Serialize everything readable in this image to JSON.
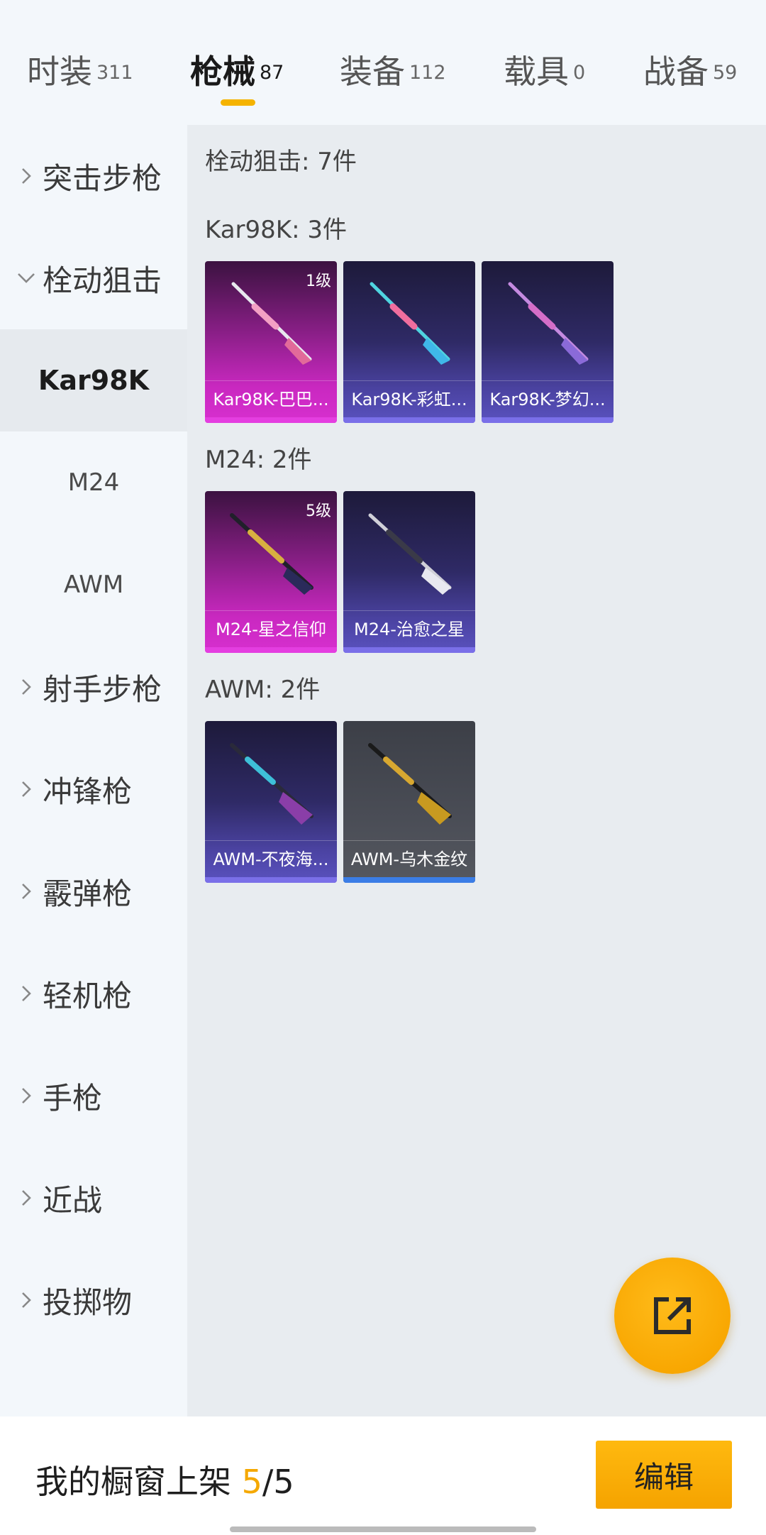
{
  "tabs": [
    {
      "label": "时装",
      "count": "311"
    },
    {
      "label": "枪械",
      "count": "87"
    },
    {
      "label": "装备",
      "count": "112"
    },
    {
      "label": "载具",
      "count": "0"
    },
    {
      "label": "战备",
      "count": "59"
    }
  ],
  "sidebar": {
    "categories": [
      "突击步枪",
      "栓动狙击",
      "射手步枪",
      "冲锋枪",
      "霰弹枪",
      "轻机枪",
      "手枪",
      "近战",
      "投掷物"
    ],
    "subitems": [
      "Kar98K",
      "M24",
      "AWM"
    ]
  },
  "main": {
    "section_title": "栓动狙击: 7件",
    "groups": [
      {
        "title": "Kar98K: 3件",
        "items": [
          {
            "name": "Kar98K-巴巴...",
            "badge": "1级",
            "rarity": "pink"
          },
          {
            "name": "Kar98K-彩虹...",
            "badge": "",
            "rarity": "purple"
          },
          {
            "name": "Kar98K-梦幻...",
            "badge": "",
            "rarity": "purple"
          }
        ]
      },
      {
        "title": "M24: 2件",
        "items": [
          {
            "name": "M24-星之信仰",
            "badge": "5级",
            "rarity": "pink"
          },
          {
            "name": "M24-治愈之星",
            "badge": "",
            "rarity": "purple"
          }
        ]
      },
      {
        "title": "AWM: 2件",
        "items": [
          {
            "name": "AWM-不夜海...",
            "badge": "",
            "rarity": "purple"
          },
          {
            "name": "AWM-乌木金纹",
            "badge": "",
            "rarity": "grey"
          }
        ]
      }
    ]
  },
  "fab": {
    "icon": "share-external-icon"
  },
  "bottom": {
    "showcase_label": "我的橱窗上架",
    "current": "5",
    "separator": "/",
    "total": "5",
    "edit_label": "编辑"
  },
  "colors": {
    "accent": "#f5b300",
    "rarity_pink": "#d730cf",
    "rarity_purple": "#5a52bf",
    "rarity_grey": "#55585f"
  }
}
